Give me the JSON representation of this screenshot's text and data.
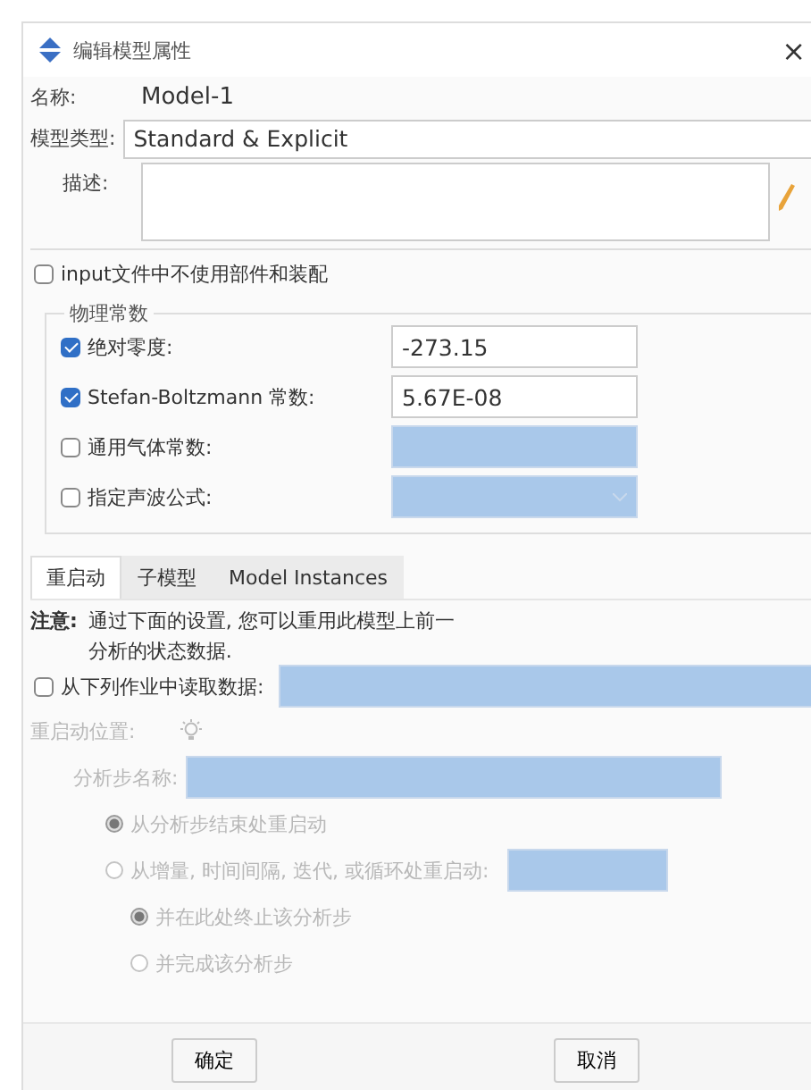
{
  "window": {
    "title": "编辑模型属性",
    "close": "×"
  },
  "name": {
    "label": "名称:",
    "value": "Model-1"
  },
  "model_type": {
    "label": "模型类型:",
    "value": "Standard & Explicit"
  },
  "description": {
    "label": "描述:"
  },
  "no_parts_option": {
    "label": "input文件中不使用部件和装配",
    "checked": false
  },
  "physical_constants": {
    "title": "物理常数",
    "rows": [
      {
        "label": "绝对零度:",
        "checked": true,
        "value": "-273.15",
        "kind": "text"
      },
      {
        "label": "Stefan-Boltzmann 常数:",
        "checked": true,
        "value": "5.67E-08",
        "kind": "text"
      },
      {
        "label": "通用气体常数:",
        "checked": false,
        "kind": "text"
      },
      {
        "label": "指定声波公式:",
        "checked": false,
        "kind": "dropdown"
      }
    ]
  },
  "tabs": [
    {
      "label": "重启动",
      "selected": true
    },
    {
      "label": "子模型",
      "selected": false
    },
    {
      "label": "Model Instances",
      "selected": false
    }
  ],
  "restart": {
    "note_label": "注意:",
    "note_lines": [
      "通过下面的设置, 您可以重用此模型上前一",
      "分析的状态数据."
    ],
    "read_from_job": {
      "label": "从下列作业中读取数据:",
      "checked": false
    },
    "disabled": true,
    "location_label": "重启动位置:",
    "step_name_label": "分析步名称:",
    "restart_options": [
      {
        "label": "从分析步结束处重启动",
        "selected": true,
        "has_field": false
      },
      {
        "label": "从增量, 时间间隔, 迭代, 或循环处重启动:",
        "selected": false,
        "has_field": true
      }
    ],
    "end_options": [
      {
        "label": "并在此处终止该分析步",
        "selected": true
      },
      {
        "label": "并完成该分析步",
        "selected": false
      }
    ]
  },
  "buttons": [
    "确定",
    "取消"
  ]
}
